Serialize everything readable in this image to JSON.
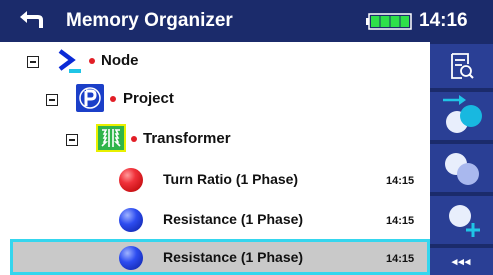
{
  "header": {
    "title": "Memory Organizer",
    "time": "14:16",
    "icons": {
      "back": "back-arrow-icon",
      "battery": "battery-icon"
    }
  },
  "tree": {
    "nodes": [
      {
        "label": "Node",
        "icon": "node-icon",
        "expanded": true
      },
      {
        "label": "Project",
        "icon": "project-icon",
        "expanded": true
      },
      {
        "label": "Transformer",
        "icon": "transformer-icon",
        "expanded": true
      }
    ],
    "measurements": [
      {
        "label": "Turn Ratio (1 Phase)",
        "time": "14:15",
        "status": "red"
      },
      {
        "label": "Resistance (1 Phase)",
        "time": "14:15",
        "status": "blue"
      },
      {
        "label": "Resistance (1 Phase)",
        "time": "14:15",
        "status": "blue",
        "selected": true
      }
    ]
  },
  "toolbar": {
    "buttons": [
      {
        "icon": "view-results-icon"
      },
      {
        "icon": "start-retest-icon"
      },
      {
        "icon": "clone-icon"
      },
      {
        "icon": "add-new-measurement-icon"
      },
      {
        "icon": "more-icon",
        "label": "◂◂◂"
      }
    ]
  },
  "colors": {
    "header_bg": "#1b2b6b",
    "toolbar_button": "#2a3f95",
    "selection_border": "#35d6ee",
    "selection_bg": "#c9c9c9",
    "accent_cyan": "#1fc5e6",
    "status_red": "#e21e26",
    "status_blue": "#2d4cf0"
  }
}
